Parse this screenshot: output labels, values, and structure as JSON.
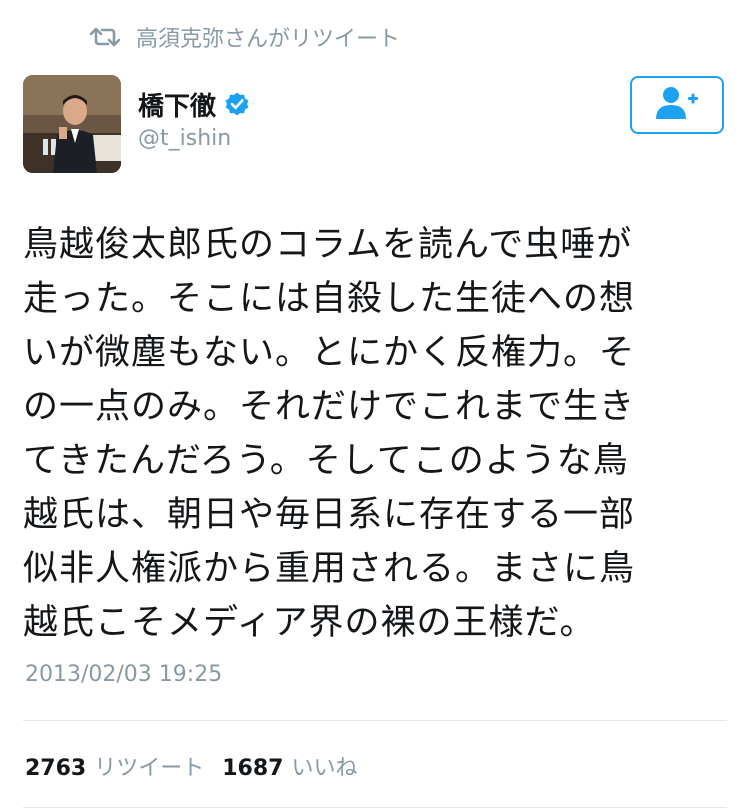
{
  "retweet_context": {
    "icon": "retweet-icon",
    "text": "高須克弥さんがリツイート"
  },
  "author": {
    "display_name": "橋下徹",
    "handle": "@t_ishin",
    "verified": true,
    "avatar": "avatar-photo"
  },
  "follow_button": {
    "icon": "add-user-icon",
    "color": "#1da1f2"
  },
  "tweet": {
    "text": "鳥越俊太郎氏のコラムを読んで虫唾が\n走った。そこには自殺した生徒への想\nいが微塵もない。とにかく反権力。そ\nの一点のみ。それだけでこれまで生き\nてきたんだろう。そしてこのような鳥\n越氏は、朝日や毎日系に存在する一部\n似非人権派から重用される。まさに鳥\n越氏こそメディア界の裸の王様だ。",
    "timestamp": "2013/02/03 19:25"
  },
  "stats": {
    "retweets": "2763",
    "retweets_label": "リツイート",
    "likes": "1687",
    "likes_label": "いいね"
  },
  "colors": {
    "accent": "#1da1f2",
    "muted": "#8899a6",
    "divider": "#e1e8ed"
  }
}
